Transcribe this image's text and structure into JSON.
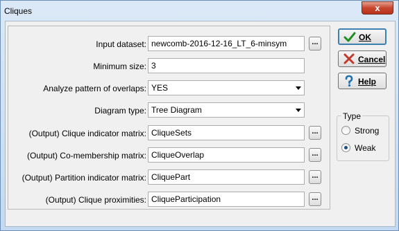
{
  "window": {
    "title": "Cliques",
    "close_symbol": "x"
  },
  "fields": [
    {
      "label": "Input dataset:",
      "value": "newcomb-2016-12-16_LT_6-minsym",
      "kind": "file",
      "browse": "..."
    },
    {
      "label": "Minimum size:",
      "value": "3",
      "kind": "text"
    },
    {
      "label": "Analyze pattern of overlaps:",
      "value": "YES",
      "kind": "select"
    },
    {
      "label": "Diagram type:",
      "value": "Tree Diagram",
      "kind": "select"
    },
    {
      "label": "(Output) Clique indicator matrix:",
      "value": "CliqueSets",
      "kind": "file",
      "browse": "..."
    },
    {
      "label": "(Output) Co-membership matrix:",
      "value": "CliqueOverlap",
      "kind": "file",
      "browse": "..."
    },
    {
      "label": "(Output) Partition indicator matrix:",
      "value": "CliquePart",
      "kind": "file",
      "browse": "..."
    },
    {
      "label": "(Output) Clique proximities:",
      "value": "CliqueParticipation",
      "kind": "file",
      "browse": "..."
    }
  ],
  "buttons": {
    "ok": {
      "label": "OK",
      "icon": "checkmark-icon"
    },
    "cancel": {
      "label": "Cancel",
      "icon": "cross-icon"
    },
    "help": {
      "label": "Help",
      "icon": "question-icon"
    }
  },
  "type_group": {
    "legend": "Type",
    "options": [
      {
        "label": "Strong",
        "checked": false
      },
      {
        "label": "Weak",
        "checked": true
      }
    ]
  },
  "colors": {
    "checkmark": "#1e8f1e",
    "cross": "#c0392b",
    "question": "#1f6fb2"
  }
}
